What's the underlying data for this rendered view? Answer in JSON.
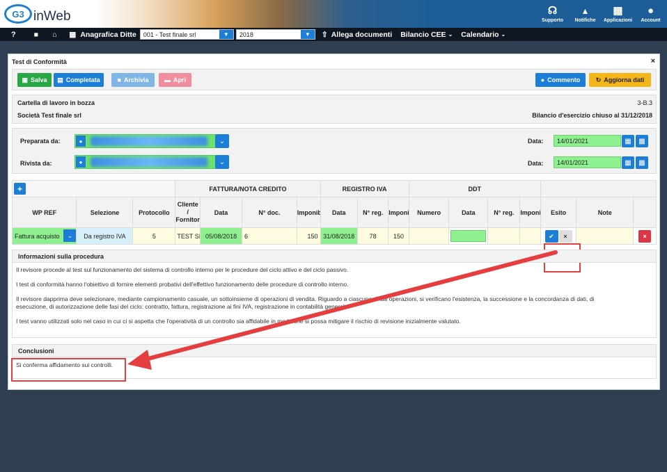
{
  "app": {
    "name": "inWeb",
    "logo_mark": "G3"
  },
  "topicons": [
    {
      "icon": "headset-icon",
      "glyph": "☊",
      "label": "Supporto"
    },
    {
      "icon": "bell-icon",
      "glyph": "🔔",
      "label": "Notifiche"
    },
    {
      "icon": "grid-icon",
      "glyph": "▦",
      "label": "Applicazioni"
    },
    {
      "icon": "account-icon",
      "glyph": "●",
      "label": "Account"
    }
  ],
  "nav": {
    "help": "?",
    "anagrafica_label": "Anagrafica Ditte",
    "company_select": "001 - Test finale srl",
    "year_select": "2018",
    "allega": "Allega documenti",
    "bilancio": "Bilancio CEE",
    "calendario": "Calendario"
  },
  "panel": {
    "title": "Test di Conformità",
    "close": "×"
  },
  "toolbar": {
    "salva": "Salva",
    "completata": "Completata",
    "archivia": "Archivia",
    "apri": "Apri",
    "commento": "Commento",
    "aggiorna": "Aggiorna dati"
  },
  "info": {
    "status": "Cartella di lavoro in bozza",
    "code": "3-B.3",
    "company": "Società Test finale srl",
    "bilancio": "Bilancio d'esercizio chiuso al 31/12/2018"
  },
  "sign": {
    "preparata_label": "Preparata da:",
    "rivista_label": "Rivista da:",
    "data_label": "Data:",
    "preparata_date": "14/01/2021",
    "rivista_date": "14/01/2021"
  },
  "grid": {
    "group_fattura": "FATTURA/NOTA CREDITO",
    "group_registro": "REGISTRO IVA",
    "group_ddt": "DDT",
    "headers": [
      "WP REF",
      "Selezione",
      "Protocollo",
      "Cliente / Fornitore",
      "Data",
      "N° doc.",
      "Imponibile",
      "Data",
      "N° reg.",
      "Imponibile",
      "Numero",
      "Data",
      "N° reg.",
      "Imponibile",
      "Esito",
      "Note"
    ],
    "row": {
      "wpref": "Fattura acquisto",
      "selezione": "Da registro IVA",
      "protocollo": "5",
      "cliente": "TEST SRL",
      "f_data": "05/08/2018",
      "f_ndoc": "6",
      "f_imp": "150",
      "r_data": "31/08/2018",
      "r_nreg": "78",
      "r_imp": "150",
      "esito_ok": "✔",
      "esito_x": "×",
      "delete": "×"
    }
  },
  "procedura": {
    "title": "Informazioni sulla procedura",
    "p1": "Il revisore procede al test sul funzionamento del sistema di controllo interno per le procedure del ciclo attivo e del ciclo passivo.",
    "p2": "I test di conformità hanno l'obiettivo di fornire elementi probativi dell'effettivo funzionamento delle procedure di controllo interno.",
    "p3a": "Il revisore dapprima deve selezionare, mediante campionamento casuale, un sottoinsieme di operazioni di vendita. Riguardo a ciascuna di tali operazioni, si verificano l'esistenza, la successione e la concordanza di dati, di",
    "p3b": "esecuzione, di autorizzazione delle fasi del ciclo: contratto, fattura, registrazione ai fini IVA, registrazione in contabilità generale.",
    "p4": "I test vanno utilizzati solo nel caso in cui ci si aspetta che l'operatività di un controllo sia affidabile in modo che si possa mitigare il rischio di revisione inizialmente valutato."
  },
  "conclusioni": {
    "title": "Conclusioni",
    "text": "Si conferma affidamento sui controlli."
  },
  "colors": {
    "accent": "#1c7ed6",
    "success": "#27a844",
    "callout": "#e53e3e"
  }
}
